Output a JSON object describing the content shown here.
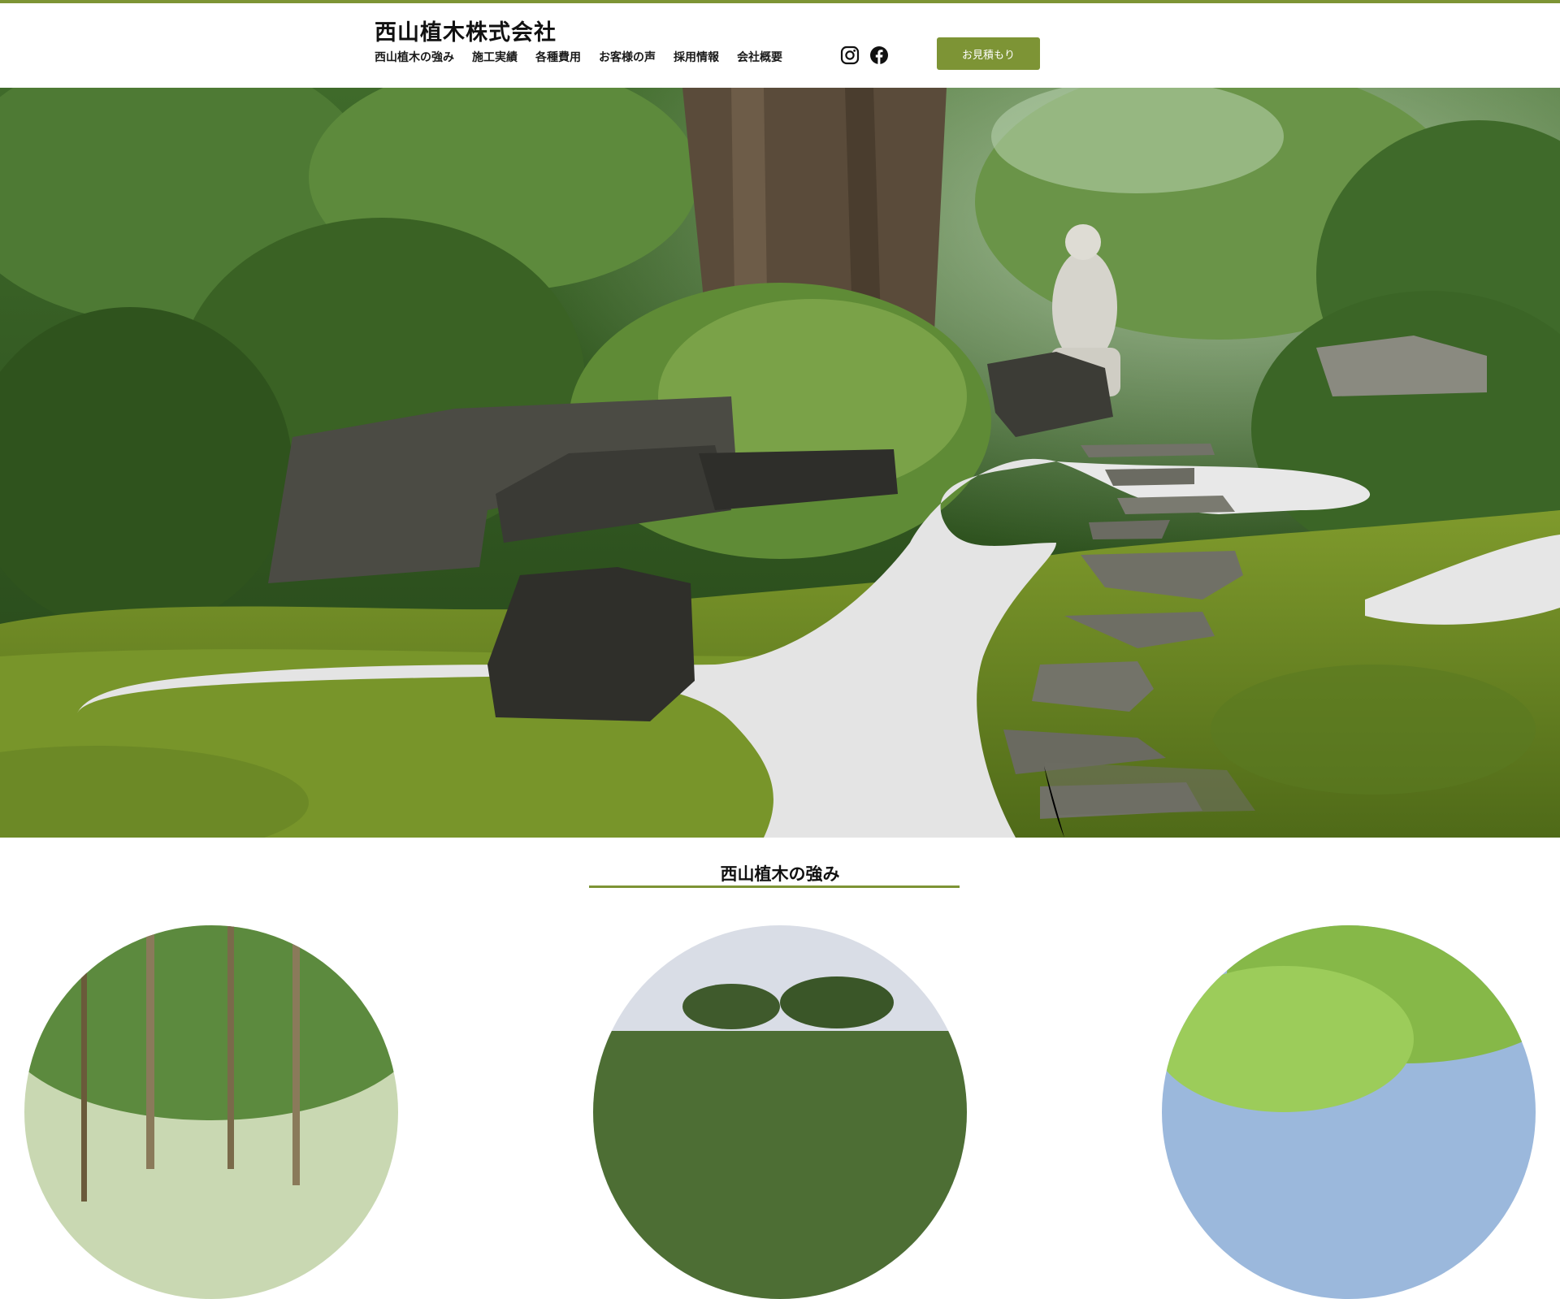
{
  "brand": {
    "name": "西山植木株式会社",
    "accent": "#7d9435"
  },
  "nav": {
    "items": [
      "西山植木の強み",
      "施工実績",
      "各種費用",
      "お客様の声",
      "採用情報",
      "会社概要"
    ]
  },
  "social": {
    "icons": [
      "instagram-icon",
      "facebook-icon"
    ]
  },
  "cta": {
    "label": "お見積もり"
  },
  "hero": {
    "image": "japanese-garden-photo"
  },
  "strengths": {
    "title": "西山植木の強み"
  }
}
